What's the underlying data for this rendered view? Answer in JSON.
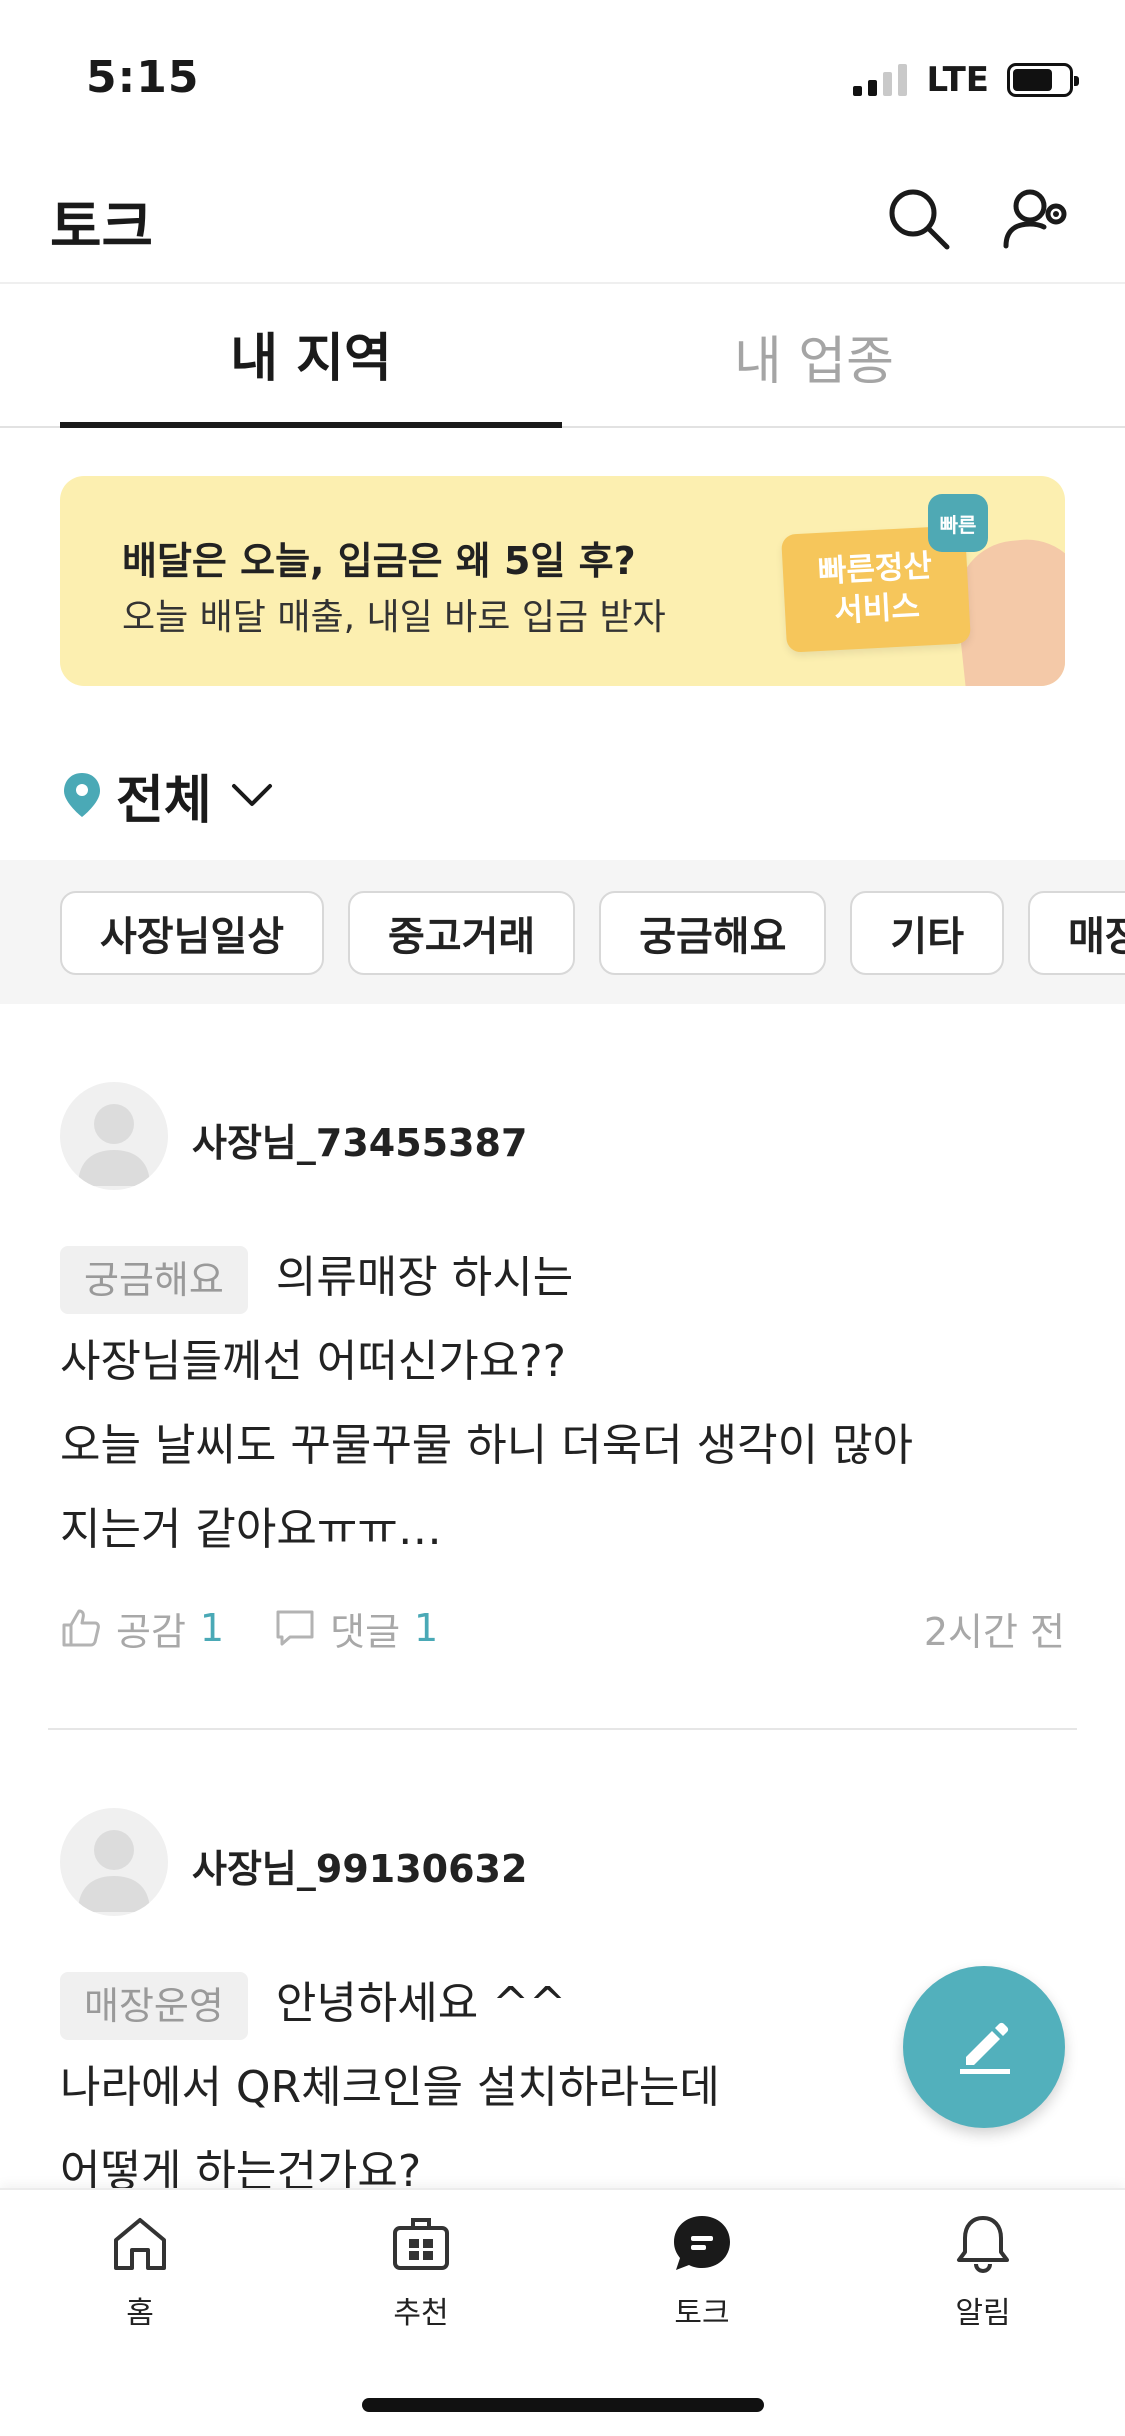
{
  "status_bar": {
    "time": "5:15",
    "network": "LTE"
  },
  "header": {
    "title": "토크",
    "icons": [
      "search-icon",
      "user-settings-icon"
    ]
  },
  "tabs": [
    {
      "label": "내 지역",
      "active": true
    },
    {
      "label": "내 업종",
      "active": false
    }
  ],
  "banner": {
    "title": "배달은 오늘, 입금은 왜 5일 후?",
    "subtitle": "오늘 배달 매출, 내일 바로 입금 받자",
    "card_line1": "빠른정산",
    "card_line2": "서비스",
    "badge": "빠른"
  },
  "region_filter": {
    "label": "전체"
  },
  "chips": [
    "사장님일상",
    "중고거래",
    "궁금해요",
    "기타",
    "매장운영"
  ],
  "posts": [
    {
      "username": "사장님_73455387",
      "category": "궁금해요",
      "first_line": "의류매장 하시는",
      "lines": [
        "사장님들께선 어떠신가요??",
        "오늘 날씨도 꾸물꾸물 하니  더욱더  생각이 많아",
        "지는거 같아요ㅠㅠ…"
      ],
      "like_label": "공감",
      "like_count": "1",
      "comment_label": "댓글",
      "comment_count": "1",
      "time": "2시간 전"
    },
    {
      "username": "사장님_99130632",
      "category": "매장운영",
      "first_line": "안녕하세요 ^^",
      "lines": [
        "나라에서 QR체크인을 설치하라는데",
        "어떻게 하는건가요?"
      ]
    }
  ],
  "bottom_nav": [
    {
      "label": "홈",
      "icon": "home-icon"
    },
    {
      "label": "추천",
      "icon": "gift-icon"
    },
    {
      "label": "토크",
      "icon": "chat-icon",
      "active": true
    },
    {
      "label": "알림",
      "icon": "bell-icon"
    }
  ],
  "colors": {
    "accent": "#52b0bc",
    "banner_bg": "#fcefb0",
    "count": "#4aa9b6"
  }
}
